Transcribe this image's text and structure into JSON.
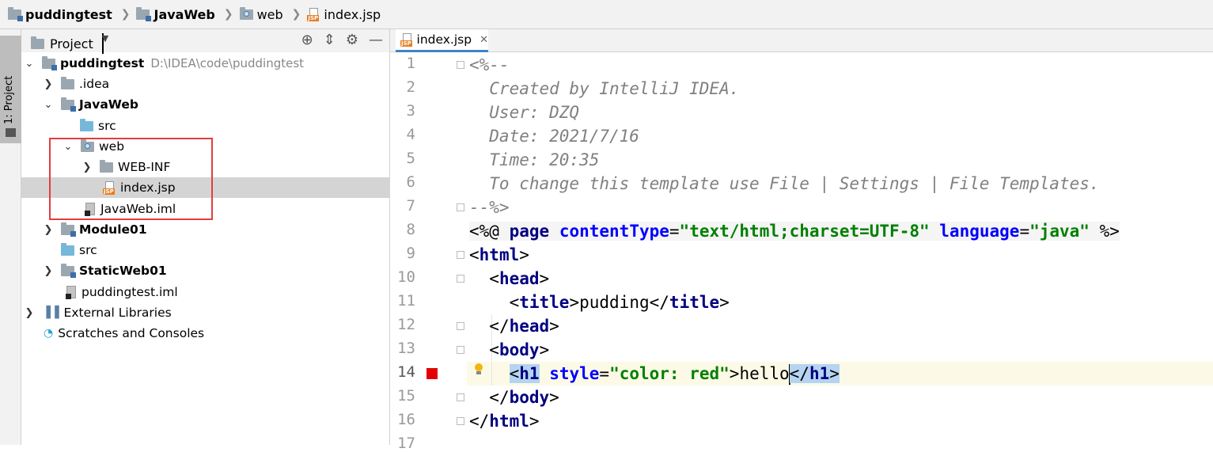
{
  "breadcrumb": [
    {
      "label": "puddingtest",
      "icon": "module-folder-icon",
      "bold": true
    },
    {
      "label": "JavaWeb",
      "icon": "module-folder-icon",
      "bold": true
    },
    {
      "label": "web",
      "icon": "web-folder-icon",
      "bold": false
    },
    {
      "label": "index.jsp",
      "icon": "jsp-file-icon",
      "bold": false
    }
  ],
  "toolstrip": {
    "project_tab_label": "1: Project"
  },
  "project_panel": {
    "title": "Project",
    "tree": [
      {
        "label": "puddingtest",
        "path": "D:\\IDEA\\code\\puddingtest",
        "icon": "module-folder-icon",
        "expanded": true,
        "bold": true
      },
      {
        "label": ".idea",
        "icon": "folder-icon",
        "expanded": false
      },
      {
        "label": "JavaWeb",
        "icon": "module-folder-icon",
        "expanded": true,
        "bold": true
      },
      {
        "label": "src",
        "icon": "source-folder-icon"
      },
      {
        "label": "web",
        "icon": "web-folder-icon",
        "expanded": true
      },
      {
        "label": "WEB-INF",
        "icon": "folder-icon",
        "expanded": false
      },
      {
        "label": "index.jsp",
        "icon": "jsp-file-icon",
        "selected": true
      },
      {
        "label": "JavaWeb.iml",
        "icon": "iml-file-icon"
      },
      {
        "label": "Module01",
        "icon": "module-folder-icon",
        "expanded": false,
        "bold": true
      },
      {
        "label": "src",
        "icon": "source-folder-icon"
      },
      {
        "label": "StaticWeb01",
        "icon": "module-folder-icon",
        "expanded": false,
        "bold": true
      },
      {
        "label": "puddingtest.iml",
        "icon": "iml-file-icon"
      },
      {
        "label": "External Libraries",
        "icon": "library-icon",
        "expanded": false
      },
      {
        "label": "Scratches and Consoles",
        "icon": "scratches-icon"
      }
    ]
  },
  "editor": {
    "tab_label": "index.jsp",
    "line_numbers": [
      "1",
      "2",
      "3",
      "4",
      "5",
      "6",
      "7",
      "8",
      "9",
      "10",
      "11",
      "12",
      "13",
      "14",
      "15",
      "16",
      "17"
    ],
    "current_line": "14",
    "code": {
      "l1": "<%--",
      "l2": "  Created by IntelliJ IDEA.",
      "l3": "  User: DZQ",
      "l4": "  Date: 2021/7/16",
      "l5": "  Time: 20:35",
      "l6": "  To change this template use File | Settings | File Templates.",
      "l7": "--%>",
      "l8_open": "<%@ ",
      "l8_page": "page",
      "l8_ct": "contentType",
      "l8_eq1": "=",
      "l8_ctv": "\"text/html;charset=UTF-8\"",
      "l8_lang": "language",
      "l8_eq2": "=",
      "l8_langv": "\"java\"",
      "l8_close": " %>",
      "l9_lt": "<",
      "l9_tag": "html",
      "l9_gt": ">",
      "l10_lt": "<",
      "l10_tag": "head",
      "l10_gt": ">",
      "l11_lt1": "<",
      "l11_tag1": "title",
      "l11_gt1": ">",
      "l11_text": "pudding",
      "l11_lt2": "</",
      "l11_tag2": "title",
      "l11_gt2": ">",
      "l12_lt": "</",
      "l12_tag": "head",
      "l12_gt": ">",
      "l13_lt": "<",
      "l13_tag": "body",
      "l13_gt": ">",
      "l14_lt1": "<",
      "l14_tag1": "h1",
      "l14_attr": "style",
      "l14_eq": "=",
      "l14_val": "\"color: red\"",
      "l14_gt1": ">",
      "l14_text": "hello",
      "l14_lt2": "</",
      "l14_tag2": "h1",
      "l14_gt2": ">",
      "l15_lt": "</",
      "l15_tag": "body",
      "l15_gt": ">",
      "l16_lt": "</",
      "l16_tag": "html",
      "l16_gt": ">"
    }
  }
}
